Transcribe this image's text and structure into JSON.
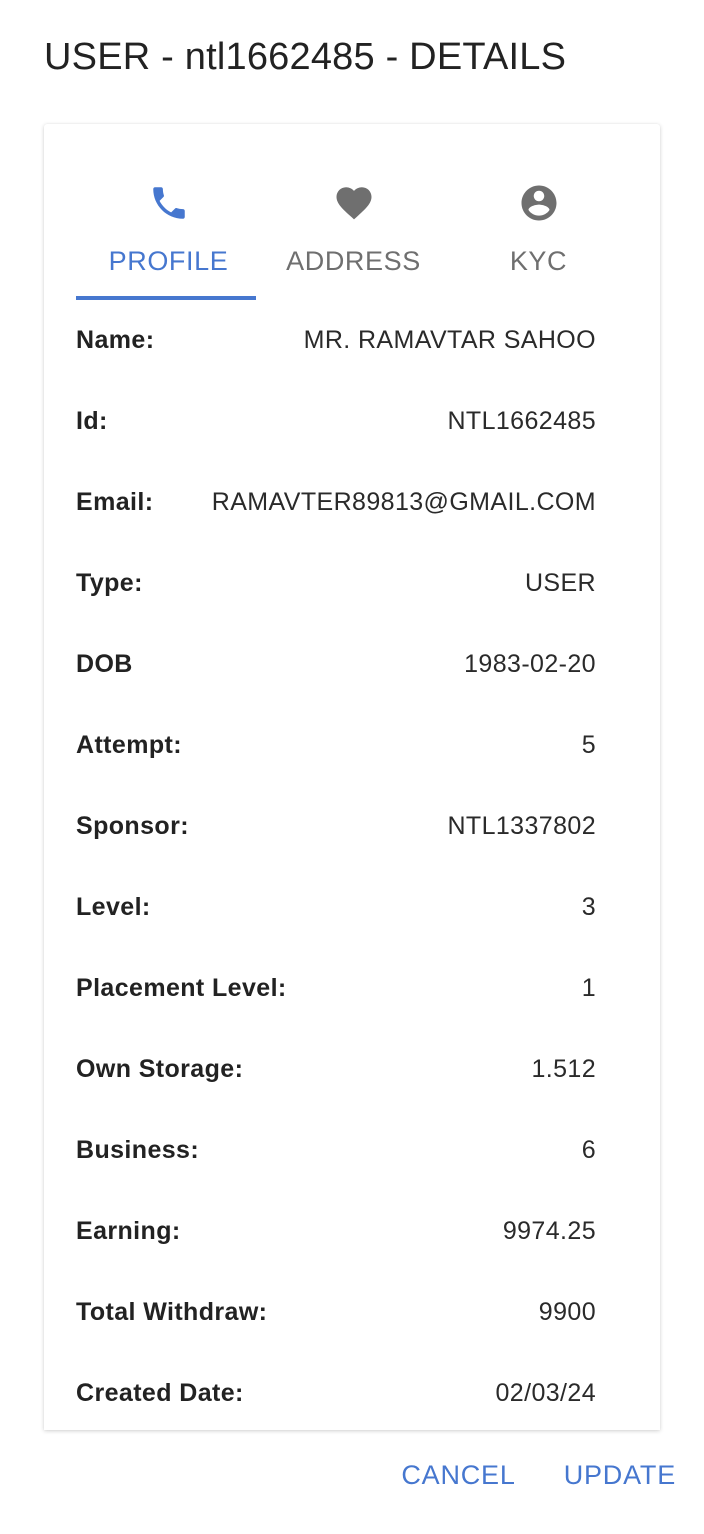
{
  "dialog": {
    "title": "USER - ntl1662485 - DETAILS"
  },
  "tabs": [
    {
      "label": "PROFILE",
      "icon": "phone-icon",
      "active": true
    },
    {
      "label": "ADDRESS",
      "icon": "heart-icon",
      "active": false
    },
    {
      "label": "KYC",
      "icon": "account-circle-icon",
      "active": false
    }
  ],
  "profile": {
    "rows": [
      {
        "label": "Name:",
        "value": "MR. RAMAVTAR SAHOO"
      },
      {
        "label": "Id:",
        "value": "NTL1662485"
      },
      {
        "label": "Email:",
        "value": "RAMAVTER89813@GMAIL.COM"
      },
      {
        "label": "Type:",
        "value": "USER"
      },
      {
        "label": "DOB",
        "value": "1983-02-20"
      },
      {
        "label": "Attempt:",
        "value": "5"
      },
      {
        "label": "Sponsor:",
        "value": "NTL1337802"
      },
      {
        "label": "Level:",
        "value": "3"
      },
      {
        "label": "Placement Level:",
        "value": "1"
      },
      {
        "label": "Own Storage:",
        "value": "1.512"
      },
      {
        "label": "Business:",
        "value": "6"
      },
      {
        "label": "Earning:",
        "value": "9974.25"
      },
      {
        "label": "Total Withdraw:",
        "value": "9900"
      },
      {
        "label": "Created Date:",
        "value": "02/03/24"
      }
    ]
  },
  "actions": {
    "cancel_label": "CANCEL",
    "update_label": "UPDATE"
  },
  "colors": {
    "accent": "#4677cf",
    "inactive_tab": "#6f6f6f",
    "text": "#222222"
  }
}
